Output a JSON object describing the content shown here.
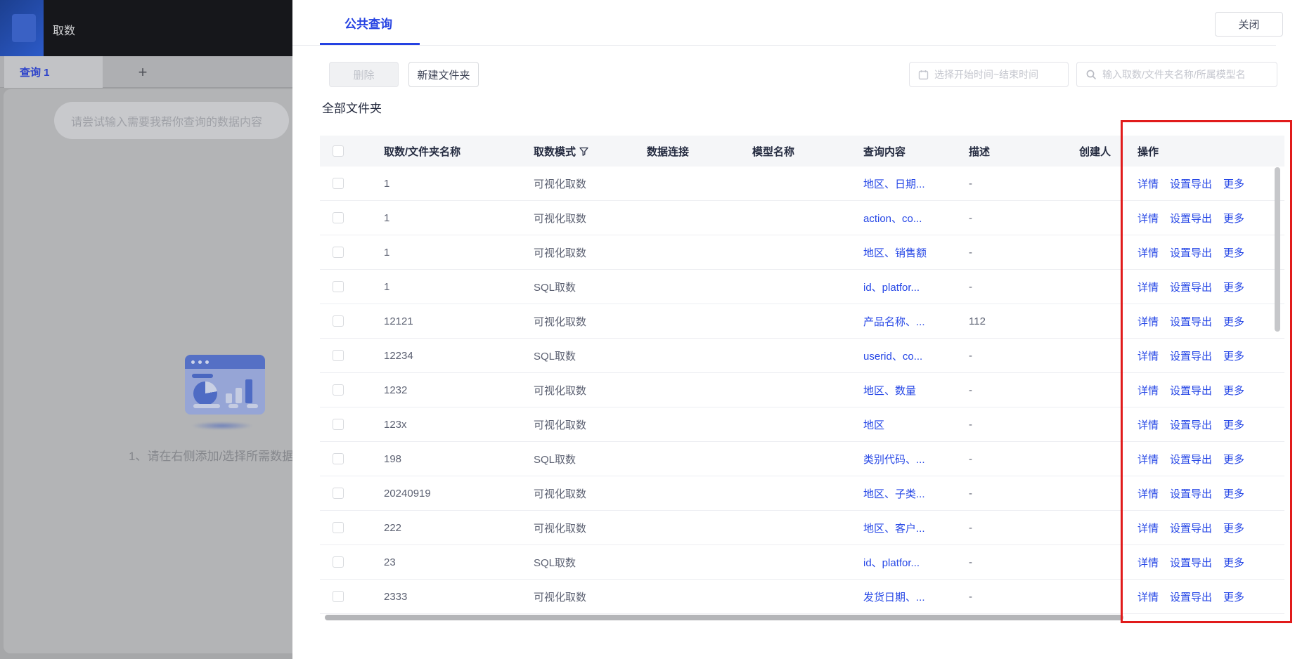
{
  "colors": {
    "accent_blue": "#2542e2",
    "link_blue": "#2647e6",
    "highlight_red": "#e11b1b"
  },
  "sidebar": {
    "app_title": "取数",
    "query_tab": "查询 1",
    "new_tab": "+",
    "input_placeholder": "请尝试输入需要我帮你查询的数据内容",
    "hint": "1、请在右侧添加/选择所需数据"
  },
  "panel": {
    "tab": "公共查询",
    "close": "关闭",
    "delete": "删除",
    "new_folder": "新建文件夹",
    "date_placeholder": "选择开始时间~结束时间",
    "search_placeholder": "输入取数/文件夹名称/所属模型名",
    "section_title": "全部文件夹"
  },
  "table": {
    "headers": [
      "",
      "取数/文件夹名称",
      "取数模式",
      "数据连接",
      "模型名称",
      "查询内容",
      "描述",
      "创建人",
      "操作"
    ],
    "action_labels": [
      "详情",
      "设置导出",
      "更多"
    ],
    "rows": [
      {
        "name": "1",
        "mode": "可视化取数",
        "connection": "",
        "model": "",
        "query": "地区、日期...",
        "desc": "-",
        "creator": ""
      },
      {
        "name": "1",
        "mode": "可视化取数",
        "connection": "",
        "model": "",
        "query": "action、co...",
        "desc": "-",
        "creator": ""
      },
      {
        "name": "1",
        "mode": "可视化取数",
        "connection": "",
        "model": "",
        "query": "地区、销售额",
        "desc": "-",
        "creator": ""
      },
      {
        "name": "1",
        "mode": "SQL取数",
        "connection": "",
        "model": "",
        "query": "id、platfor...",
        "desc": "-",
        "creator": ""
      },
      {
        "name": "12121",
        "mode": "可视化取数",
        "connection": "",
        "model": "",
        "query": "产品名称、...",
        "desc": "112",
        "creator": ""
      },
      {
        "name": "12234",
        "mode": "SQL取数",
        "connection": "",
        "model": "",
        "query": "userid、co...",
        "desc": "-",
        "creator": ""
      },
      {
        "name": "1232",
        "mode": "可视化取数",
        "connection": "",
        "model": "",
        "query": "地区、数量",
        "desc": "-",
        "creator": ""
      },
      {
        "name": "123x",
        "mode": "可视化取数",
        "connection": "",
        "model": "",
        "query": "地区",
        "desc": "-",
        "creator": ""
      },
      {
        "name": "198",
        "mode": "SQL取数",
        "connection": "",
        "model": "",
        "query": "类别代码、...",
        "desc": "-",
        "creator": ""
      },
      {
        "name": "20240919",
        "mode": "可视化取数",
        "connection": "",
        "model": "",
        "query": "地区、子类...",
        "desc": "-",
        "creator": ""
      },
      {
        "name": "222",
        "mode": "可视化取数",
        "connection": "",
        "model": "",
        "query": "地区、客户...",
        "desc": "-",
        "creator": ""
      },
      {
        "name": "23",
        "mode": "SQL取数",
        "connection": "",
        "model": "",
        "query": "id、platfor...",
        "desc": "-",
        "creator": ""
      },
      {
        "name": "2333",
        "mode": "可视化取数",
        "connection": "",
        "model": "",
        "query": "发货日期、...",
        "desc": "-",
        "creator": ""
      }
    ]
  }
}
